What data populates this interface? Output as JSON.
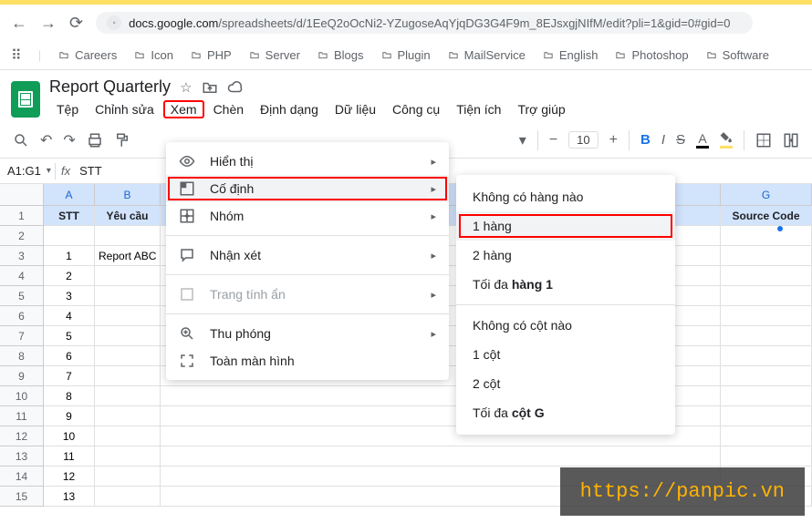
{
  "browser": {
    "url_domain": "docs.google.com",
    "url_path": "/spreadsheets/d/1EeQ2oOcNi2-YZugoseAqYjqDG3G4F9m_8EJsxgjNIfM/edit?pli=1&gid=0#gid=0"
  },
  "bookmarks": [
    "Careers",
    "Icon",
    "PHP",
    "Server",
    "Blogs",
    "Plugin",
    "MailService",
    "English",
    "Photoshop",
    "Software"
  ],
  "doc": {
    "title": "Report Quarterly"
  },
  "menus": [
    "Tệp",
    "Chỉnh sửa",
    "Xem",
    "Chèn",
    "Định dạng",
    "Dữ liệu",
    "Công cụ",
    "Tiện ích",
    "Trợ giúp"
  ],
  "toolbar": {
    "font_size": "10"
  },
  "cell_ref": "A1:G1",
  "fx_value": "STT",
  "columns": {
    "A": "A",
    "B": "B",
    "G": "G"
  },
  "header_row": {
    "stt": "STT",
    "yeucau": "Yêu cầu",
    "source": "Source Code"
  },
  "rows_colA": [
    "1",
    "2",
    "3",
    "4",
    "5",
    "6",
    "7",
    "8",
    "9",
    "10",
    "11",
    "12",
    "13"
  ],
  "row3_b": "Report ABC",
  "view_menu": {
    "hien_thi": "Hiển thị",
    "co_dinh": "Cố định",
    "nhom": "Nhóm",
    "nhan_xet": "Nhận xét",
    "trang_an": "Trang tính ẩn",
    "thu_phong": "Thu phóng",
    "toan_man_hinh": "Toàn màn hình"
  },
  "freeze_menu": {
    "no_rows": "Không có hàng nào",
    "row1": "1 hàng",
    "row2": "2 hàng",
    "up_to_row_prefix": "Tối đa ",
    "up_to_row_bold": "hàng 1",
    "no_cols": "Không có cột nào",
    "col1": "1 cột",
    "col2": "2 cột",
    "up_to_col_prefix": "Tối đa ",
    "up_to_col_bold": "cột G"
  },
  "watermark": "https://panpic.vn"
}
